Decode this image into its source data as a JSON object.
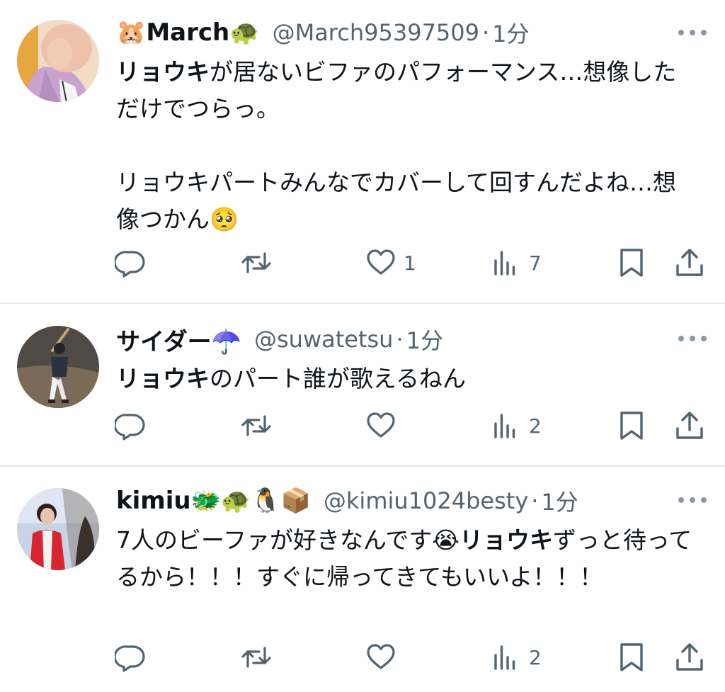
{
  "tweets": [
    {
      "display_name": "🐹March🐢",
      "handle": "@March95397509",
      "separator": "·",
      "time": "1分",
      "text_segments": [
        {
          "bold": true,
          "text": "リョウキ"
        },
        {
          "bold": false,
          "text": "が居ないビファのパフォーマンス…想像しただけでつらっ。\n\nリョウキパートみんなでカバーして回すんだよね…想像つかん🥺"
        }
      ],
      "reply_count": "",
      "retweet_count": "",
      "like_count": "1",
      "view_count": "7"
    },
    {
      "display_name": "サイダー☂️",
      "handle": "@suwatetsu",
      "separator": "·",
      "time": "1分",
      "text_segments": [
        {
          "bold": true,
          "text": "リョウキ"
        },
        {
          "bold": false,
          "text": "のパート誰が歌えるねん"
        }
      ],
      "reply_count": "",
      "retweet_count": "",
      "like_count": "",
      "view_count": "2"
    },
    {
      "display_name": "kimiu🐲🐢🐧📦",
      "handle": "@kimiu1024besty",
      "separator": "·",
      "time": "1分",
      "text_segments": [
        {
          "bold": false,
          "text": "7人のビーファが好きなんです😭"
        },
        {
          "bold": true,
          "text": "リョウキ"
        },
        {
          "bold": false,
          "text": "ずっと待ってるから！！！すぐに帰ってきてもいいよ！！！"
        }
      ],
      "reply_count": "",
      "retweet_count": "",
      "like_count": "",
      "view_count": "2"
    }
  ],
  "icons": {
    "reply": "reply-icon",
    "retweet": "retweet-icon",
    "like": "heart-icon",
    "views": "views-icon",
    "bookmark": "bookmark-icon",
    "share": "share-icon",
    "more": "more-icon"
  },
  "colors": {
    "text": "#0f1419",
    "secondary": "#536471",
    "icon": "#536471",
    "divider": "#e6e9ec"
  }
}
